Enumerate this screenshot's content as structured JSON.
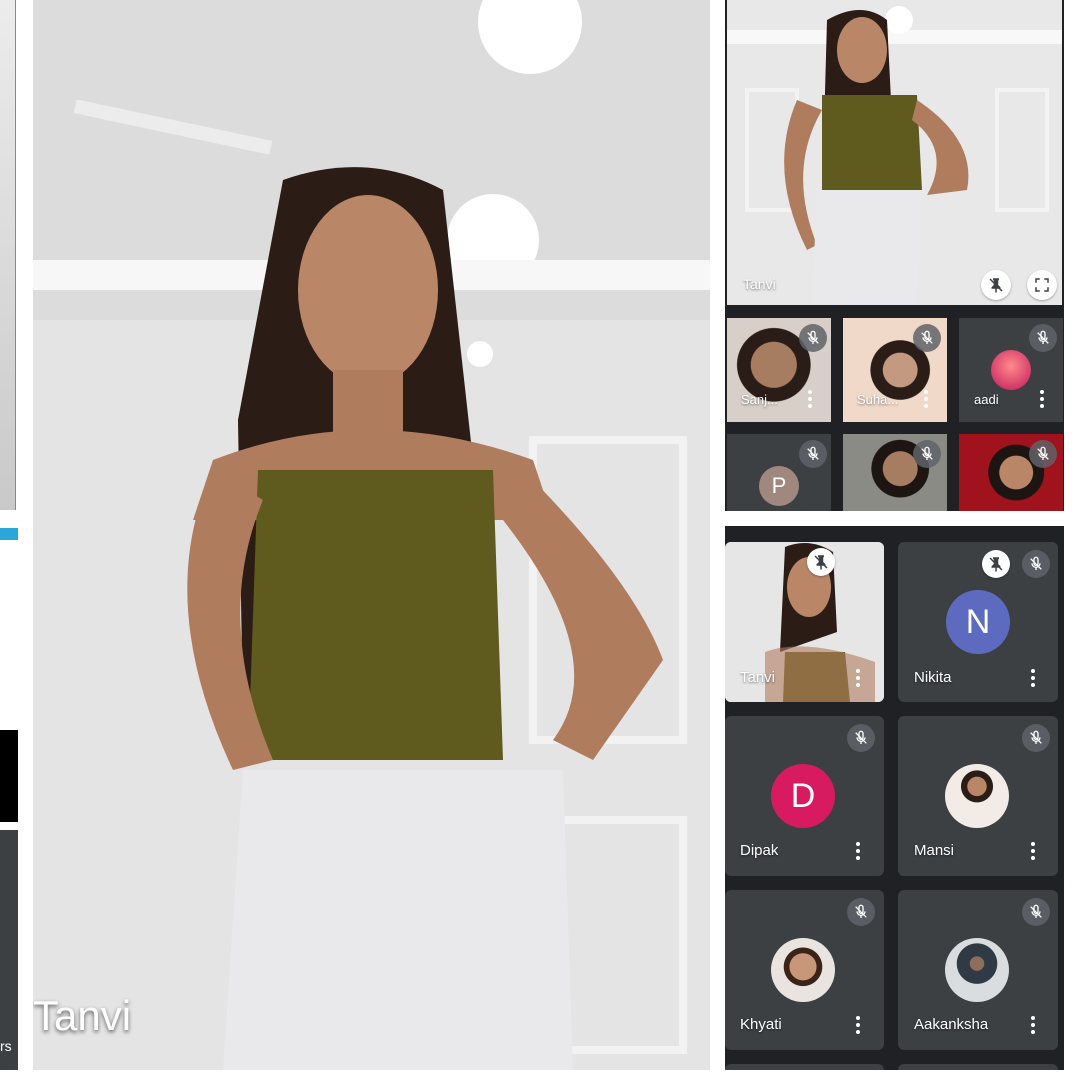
{
  "main": {
    "speaker_name": "Tanvi"
  },
  "top_panel": {
    "spotlight_name": "Tanvi",
    "tiles": [
      {
        "name": "Sanj..."
      },
      {
        "name": "Suha..."
      },
      {
        "name": "aadi"
      },
      {
        "avatar_letter": "P"
      },
      {},
      {}
    ]
  },
  "bottom_panel": {
    "tiles": [
      {
        "name": "Tanvi"
      },
      {
        "name": "Nikita",
        "avatar_letter": "N",
        "avatar_color": "#5c6bc0"
      },
      {
        "name": "Dipak",
        "avatar_letter": "D",
        "avatar_color": "#d81b60"
      },
      {
        "name": "Mansi"
      },
      {
        "name": "Khyati"
      },
      {
        "name": "Aakanksha"
      }
    ]
  },
  "left_strip": {
    "partial_text": "rs"
  },
  "colors": {
    "tile_bg": "#3c4043",
    "mute_bg": "#5f6368",
    "avatar_p": "#a1887f"
  }
}
